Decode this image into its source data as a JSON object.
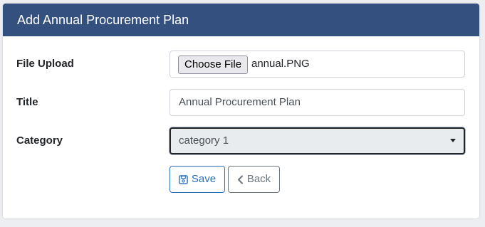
{
  "header": {
    "title": "Add Annual Procurement Plan"
  },
  "form": {
    "file_upload": {
      "label": "File Upload",
      "button_label": "Choose File",
      "file_name": "annual.PNG"
    },
    "title": {
      "label": "Title",
      "value": "Annual Procurement Plan"
    },
    "category": {
      "label": "Category",
      "selected": "category 1"
    }
  },
  "actions": {
    "save_label": "Save",
    "save_icon": "floppy-disk-icon",
    "back_label": "Back",
    "back_icon": "chevron-left-icon"
  },
  "colors": {
    "header_bg": "#34507e",
    "save_accent": "#2a6ebb",
    "back_accent": "#6c757d"
  }
}
